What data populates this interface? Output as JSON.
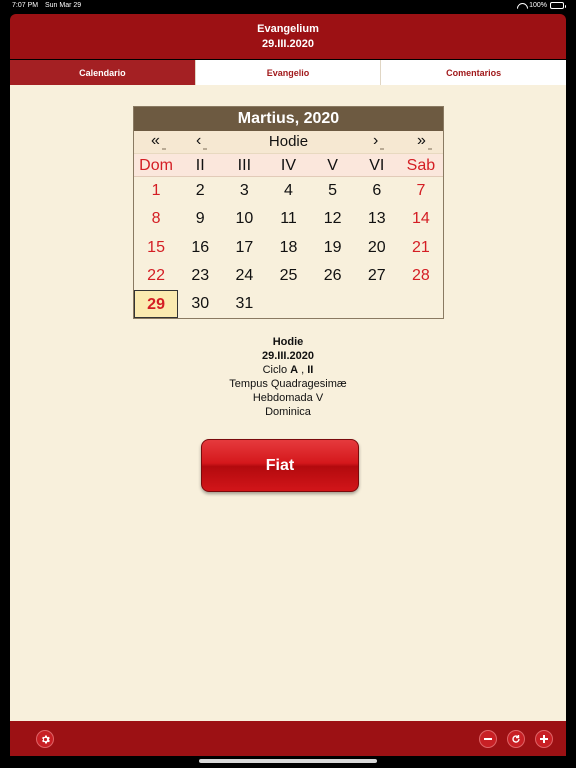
{
  "status": {
    "time": "7:07 PM",
    "date": "Sun Mar 29",
    "battery": "100%"
  },
  "header": {
    "title": "Evangelium",
    "subtitle": "29.III.2020"
  },
  "tabs": [
    {
      "label": "Calendario",
      "active": true
    },
    {
      "label": "Evangelio",
      "active": false
    },
    {
      "label": "Comentarios",
      "active": false
    }
  ],
  "calendar": {
    "month_title": "Martius, 2020",
    "nav": {
      "prev_year": "«",
      "prev_month": "‹",
      "today": "Hodie",
      "next_month": "›",
      "next_year": "»"
    },
    "weekdays": [
      "Dom",
      "II",
      "III",
      "IV",
      "V",
      "VI",
      "Sab"
    ],
    "weeks": [
      [
        "1",
        "2",
        "3",
        "4",
        "5",
        "6",
        "7"
      ],
      [
        "8",
        "9",
        "10",
        "11",
        "12",
        "13",
        "14"
      ],
      [
        "15",
        "16",
        "17",
        "18",
        "19",
        "20",
        "21"
      ],
      [
        "22",
        "23",
        "24",
        "25",
        "26",
        "27",
        "28"
      ],
      [
        "29",
        "30",
        "31",
        "",
        "",
        "",
        ""
      ]
    ],
    "selected_day": "29"
  },
  "info": {
    "label": "Hodie",
    "date": "29.III.2020",
    "cycle_prefix": "Ciclo ",
    "cycle_a": "A",
    "cycle_sep": " , ",
    "cycle_b": "II",
    "season": "Tempus Quadragesimæ",
    "week": "Hebdomada V",
    "day": "Dominica"
  },
  "fiat_button": "Fiat",
  "footer": {
    "settings_icon": "gear-icon",
    "minus_icon": "minus-icon",
    "refresh_icon": "refresh-icon",
    "plus_icon": "plus-icon"
  }
}
